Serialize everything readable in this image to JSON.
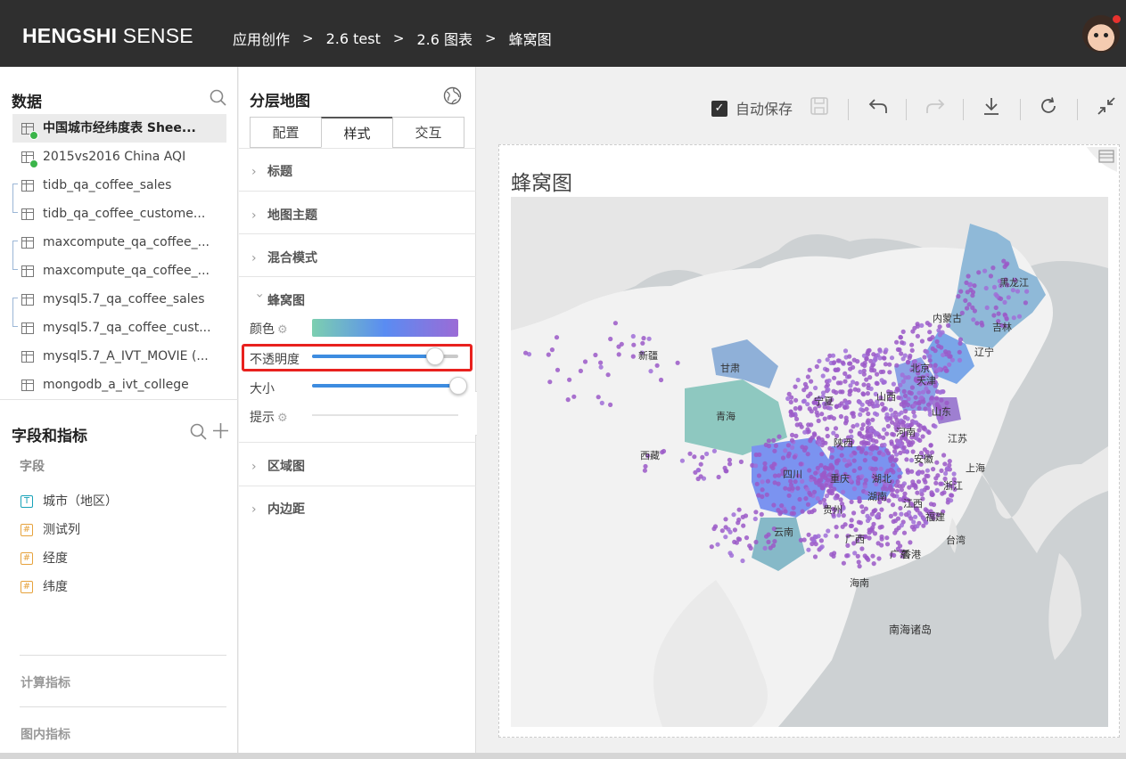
{
  "header": {
    "brand_bold": "HENGSHI",
    "brand_light": "SENSE",
    "breadcrumb": [
      "应用创作",
      "2.6 test",
      "2.6 图表",
      "蜂窝图"
    ],
    "separator": ">"
  },
  "data_panel": {
    "title": "数据",
    "datasets": [
      {
        "label": "中国城市经纬度表 Shee...",
        "active": true,
        "status": "ok"
      },
      {
        "label": "2015vs2016 China AQI",
        "active": false,
        "status": "ok"
      },
      {
        "label": "tidb_qa_coffee_sales"
      },
      {
        "label": "tidb_qa_coffee_custome..."
      },
      {
        "label": "maxcompute_qa_coffee_..."
      },
      {
        "label": "maxcompute_qa_coffee_..."
      },
      {
        "label": "mysql5.7_qa_coffee_sales"
      },
      {
        "label": "mysql5.7_qa_coffee_cust..."
      },
      {
        "label": "mysql5.7_A_IVT_MOVIE (..."
      },
      {
        "label": "mongodb_a_ivt_college"
      }
    ]
  },
  "fields_panel": {
    "title": "字段和指标",
    "fields_label": "字段",
    "fields": [
      {
        "type": "T",
        "label": "城市（地区）"
      },
      {
        "type": "#",
        "label": "测试列"
      },
      {
        "type": "#",
        "label": "经度"
      },
      {
        "type": "#",
        "label": "纬度"
      }
    ],
    "calc_label": "计算指标",
    "inner_label": "图内指标"
  },
  "config_panel": {
    "title": "分层地图",
    "tabs": [
      "配置",
      "样式",
      "交互"
    ],
    "active_tab": "样式",
    "sections": {
      "title": "标题",
      "theme": "地图主题",
      "blend": "混合模式",
      "hex": "蜂窝图",
      "region": "区域图",
      "padding": "内边距"
    },
    "hex_rows": {
      "color": "颜色",
      "opacity": "不透明度",
      "size": "大小",
      "tooltip": "提示"
    },
    "opacity_value": 0.84,
    "size_value": 1.0,
    "gradient": [
      "#7ccfb0",
      "#5a8cf2",
      "#9b6bd6"
    ]
  },
  "toolbar": {
    "autosave_label": "自动保存",
    "autosave_checked": true
  },
  "chart": {
    "title": "蜂窝图",
    "labels": {
      "heilongjiang": "黑龙江",
      "neimenggu": "内蒙古",
      "jilin": "吉林",
      "liaoning": "辽宁",
      "xinjiang": "新疆",
      "gansu": "甘肃",
      "beijing": "北京",
      "tianjin": "天津",
      "ningxia": "宁夏",
      "shanxi": "山西",
      "shandong": "山东",
      "qinghai": "青海",
      "shaanxi": "陕西",
      "henan": "河南",
      "jiangsu": "江苏",
      "xizang": "西藏",
      "anhui": "安徽",
      "sichuan": "四川",
      "hubei": "湖北",
      "shanghai": "上海",
      "chongqing": "重庆",
      "zhejiang": "浙江",
      "hunan": "湖南",
      "jiangxi": "江西",
      "guizhou": "贵州",
      "fujian": "福建",
      "yunnan": "云南",
      "guangxi": "广西",
      "guangdong": "广东",
      "taiwan": "台湾",
      "xianggang": "香港",
      "hainan": "海南",
      "nanhai": "南海诸岛"
    }
  }
}
